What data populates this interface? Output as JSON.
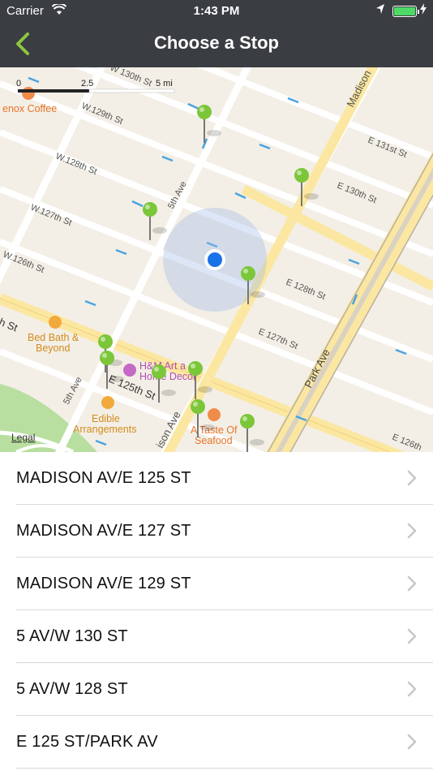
{
  "status": {
    "carrier": "Carrier",
    "time": "1:43 PM",
    "battery_level": 1.0
  },
  "nav": {
    "title": "Choose a Stop"
  },
  "map": {
    "legal": "Legal",
    "scale": {
      "zero": "0",
      "mid": "2.5",
      "max": "5 mi"
    },
    "streets": {
      "w130": "W 130th St",
      "w129": "W.129th St",
      "w128": "W.128th St",
      "w127": "W.127th St",
      "w126": "W.126th St",
      "fifth_ave_n": "5th Ave",
      "fifth_ave_s": "5th Ave",
      "madison_n": "Madison",
      "madison_s": "ison Ave",
      "e131": "E 131st St",
      "e130": "E 130th St",
      "e128": "E 128th St",
      "e127": "E 127th St",
      "e126": "E 126th",
      "e125": "E 125th St",
      "park_ave": "Park Ave",
      "left_st": "h St"
    },
    "pois": {
      "lenox": "enox Coffee",
      "bedbath_1": "Bed Bath &",
      "bedbath_2": "Beyond",
      "hm_1": "H&M Art a",
      "hm_2": "Home Decor",
      "edible_1": "Edible",
      "edible_2": "Arrangements",
      "taste_1": "A Taste Of",
      "taste_2": "Seafood"
    },
    "colors": {
      "land": "#f3efe6",
      "road": "#ffffff",
      "avenue": "#fbe7a1",
      "park": "#b9dfa0",
      "pin": "#7cc63a",
      "user": "#1a73e8",
      "accent": "#8dc63f"
    }
  },
  "stops": [
    {
      "label": "MADISON AV/E 125 ST"
    },
    {
      "label": "MADISON AV/E 127 ST"
    },
    {
      "label": "MADISON AV/E 129 ST"
    },
    {
      "label": "5 AV/W 130 ST"
    },
    {
      "label": "5 AV/W 128 ST"
    },
    {
      "label": "E 125 ST/PARK AV"
    }
  ]
}
